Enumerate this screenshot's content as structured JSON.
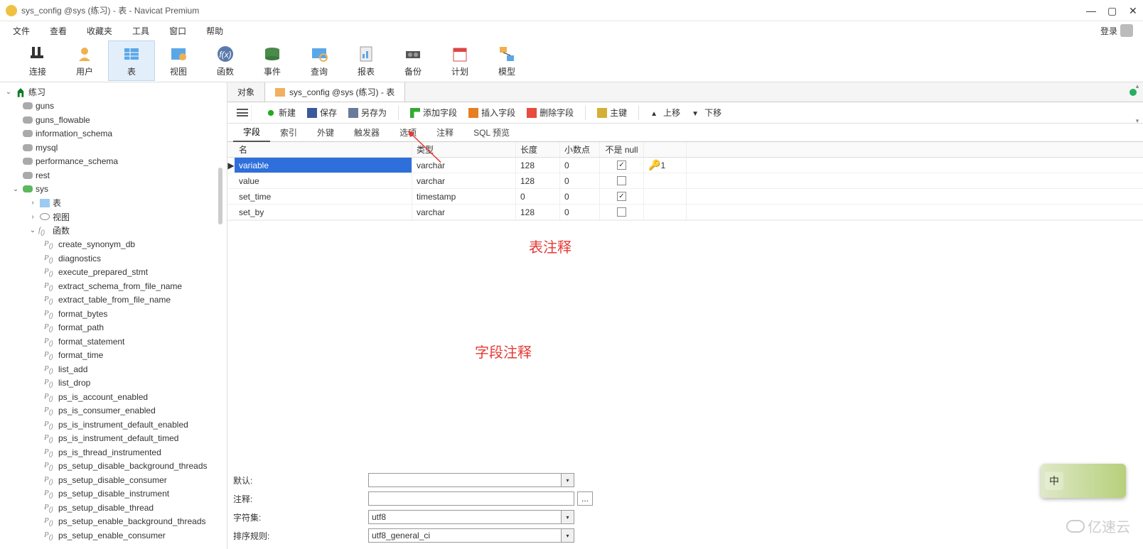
{
  "titlebar": {
    "title": "sys_config @sys (练习) - 表 - Navicat Premium"
  },
  "menubar": {
    "items": [
      "文件",
      "查看",
      "收藏夹",
      "工具",
      "窗口",
      "帮助"
    ],
    "login": "登录"
  },
  "toolbar": {
    "items": [
      {
        "label": "连接"
      },
      {
        "label": "用户"
      },
      {
        "label": "表"
      },
      {
        "label": "视图"
      },
      {
        "label": "函数"
      },
      {
        "label": "事件"
      },
      {
        "label": "查询"
      },
      {
        "label": "报表"
      },
      {
        "label": "备份"
      },
      {
        "label": "计划"
      },
      {
        "label": "模型"
      }
    ]
  },
  "tree": {
    "connection": "练习",
    "databases": [
      "guns",
      "guns_flowable",
      "information_schema",
      "mysql",
      "performance_schema",
      "rest",
      "sys"
    ],
    "sys_children": {
      "table": "表",
      "view": "视图",
      "func": "函数"
    },
    "functions": [
      "create_synonym_db",
      "diagnostics",
      "execute_prepared_stmt",
      "extract_schema_from_file_name",
      "extract_table_from_file_name",
      "format_bytes",
      "format_path",
      "format_statement",
      "format_time",
      "list_add",
      "list_drop",
      "ps_is_account_enabled",
      "ps_is_consumer_enabled",
      "ps_is_instrument_default_enabled",
      "ps_is_instrument_default_timed",
      "ps_is_thread_instrumented",
      "ps_setup_disable_background_threads",
      "ps_setup_disable_consumer",
      "ps_setup_disable_instrument",
      "ps_setup_disable_thread",
      "ps_setup_enable_background_threads",
      "ps_setup_enable_consumer"
    ]
  },
  "ctabs": {
    "object": "对象",
    "current": "sys_config @sys (练习) - 表"
  },
  "designer": {
    "new": "新建",
    "save": "保存",
    "saveas": "另存为",
    "addfield": "添加字段",
    "insfield": "插入字段",
    "delfield": "删除字段",
    "pk": "主键",
    "up": "上移",
    "down": "下移"
  },
  "fieldtabs": [
    "字段",
    "索引",
    "外键",
    "触发器",
    "选项",
    "注释",
    "SQL 预览"
  ],
  "grid": {
    "headers": {
      "name": "名",
      "type": "类型",
      "len": "长度",
      "dec": "小数点",
      "null": "不是 null"
    },
    "rows": [
      {
        "name": "variable",
        "type": "varchar",
        "len": "128",
        "dec": "0",
        "notnull": true,
        "key": "1"
      },
      {
        "name": "value",
        "type": "varchar",
        "len": "128",
        "dec": "0",
        "notnull": false,
        "key": ""
      },
      {
        "name": "set_time",
        "type": "timestamp",
        "len": "0",
        "dec": "0",
        "notnull": true,
        "key": ""
      },
      {
        "name": "set_by",
        "type": "varchar",
        "len": "128",
        "dec": "0",
        "notnull": false,
        "key": ""
      }
    ]
  },
  "annotations": {
    "table_comment": "表注释",
    "field_comment": "字段注释"
  },
  "props": {
    "default": {
      "label": "默认:",
      "value": ""
    },
    "comment": {
      "label": "注释:",
      "value": ""
    },
    "charset": {
      "label": "字符集:",
      "value": "utf8"
    },
    "collation": {
      "label": "排序规则:",
      "value": "utf8_general_ci"
    }
  },
  "ime": {
    "mode": "中"
  },
  "watermark": "亿速云"
}
